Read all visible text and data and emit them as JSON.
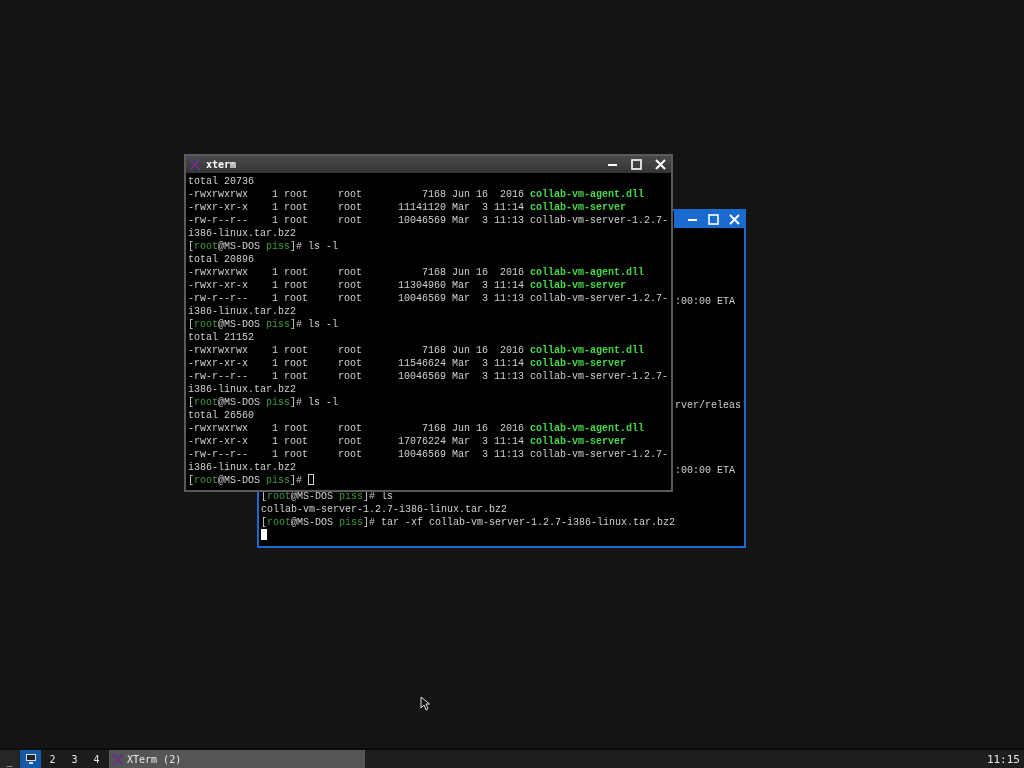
{
  "windows": [
    {
      "kind": "back",
      "focused": true,
      "lines": [
        {
          "kind": "blank"
        },
        {
          "kind": "blank"
        },
        {
          "kind": "blank"
        },
        {
          "kind": "blank"
        },
        {
          "kind": "blank"
        },
        {
          "kind": "tail",
          "segments": [
            {
              "kind": "plain",
              "text": ":00:00 ETA"
            }
          ]
        },
        {
          "kind": "blank"
        },
        {
          "kind": "blank"
        },
        {
          "kind": "blank"
        },
        {
          "kind": "blank"
        },
        {
          "kind": "blank"
        },
        {
          "kind": "blank"
        },
        {
          "kind": "blank"
        },
        {
          "kind": "tail",
          "segments": [
            {
              "kind": "plain",
              "text": "rver/releas"
            }
          ]
        },
        {
          "kind": "blank"
        },
        {
          "kind": "blank"
        },
        {
          "kind": "blank"
        },
        {
          "kind": "blank"
        },
        {
          "kind": "tail",
          "segments": [
            {
              "kind": "plain",
              "text": ":00:00 ETA"
            }
          ]
        },
        {
          "kind": "blank"
        },
        {
          "kind": "full",
          "segments": [
            {
              "kind": "plain",
              "text": "["
            },
            {
              "kind": "prompt",
              "text": "root"
            },
            {
              "kind": "plain",
              "text": "@MS-DOS "
            },
            {
              "kind": "prompt",
              "text": "piss"
            },
            {
              "kind": "plain",
              "text": "]# ls"
            }
          ]
        },
        {
          "kind": "full",
          "segments": [
            {
              "kind": "plain",
              "text": "collab-vm-server-1.2.7-i386-linux.tar.bz2"
            }
          ]
        },
        {
          "kind": "full",
          "segments": [
            {
              "kind": "plain",
              "text": "["
            },
            {
              "kind": "prompt",
              "text": "root"
            },
            {
              "kind": "plain",
              "text": "@MS-DOS "
            },
            {
              "kind": "prompt",
              "text": "piss"
            },
            {
              "kind": "plain",
              "text": "]# tar -xf collab-vm-server-1.2.7-i386-linux.tar.bz2"
            }
          ]
        },
        {
          "kind": "cursor"
        }
      ]
    },
    {
      "kind": "front",
      "title": "xterm",
      "focused": false,
      "lines": [
        {
          "kind": "full",
          "segments": [
            {
              "kind": "plain",
              "text": "total 20736"
            }
          ]
        },
        {
          "kind": "full",
          "segments": [
            {
              "kind": "plain",
              "text": "-rwxrwxrwx    1 root     root          7168 Jun 16  2016 "
            },
            {
              "kind": "exec",
              "text": "collab-vm-agent.dll"
            }
          ]
        },
        {
          "kind": "full",
          "segments": [
            {
              "kind": "plain",
              "text": "-rwxr-xr-x    1 root     root      11141120 Mar  3 11:14 "
            },
            {
              "kind": "exec",
              "text": "collab-vm-server"
            }
          ]
        },
        {
          "kind": "full",
          "segments": [
            {
              "kind": "plain",
              "text": "-rw-r--r--    1 root     root      10046569 Mar  3 11:13 collab-vm-server-1.2.7-"
            }
          ]
        },
        {
          "kind": "full",
          "segments": [
            {
              "kind": "plain",
              "text": "i386-linux.tar.bz2"
            }
          ]
        },
        {
          "kind": "full",
          "segments": [
            {
              "kind": "plain",
              "text": "["
            },
            {
              "kind": "prompt",
              "text": "root"
            },
            {
              "kind": "plain",
              "text": "@MS-DOS "
            },
            {
              "kind": "prompt",
              "text": "piss"
            },
            {
              "kind": "plain",
              "text": "]# ls -l"
            }
          ]
        },
        {
          "kind": "full",
          "segments": [
            {
              "kind": "plain",
              "text": "total 20896"
            }
          ]
        },
        {
          "kind": "full",
          "segments": [
            {
              "kind": "plain",
              "text": "-rwxrwxrwx    1 root     root          7168 Jun 16  2016 "
            },
            {
              "kind": "exec",
              "text": "collab-vm-agent.dll"
            }
          ]
        },
        {
          "kind": "full",
          "segments": [
            {
              "kind": "plain",
              "text": "-rwxr-xr-x    1 root     root      11304960 Mar  3 11:14 "
            },
            {
              "kind": "exec",
              "text": "collab-vm-server"
            }
          ]
        },
        {
          "kind": "full",
          "segments": [
            {
              "kind": "plain",
              "text": "-rw-r--r--    1 root     root      10046569 Mar  3 11:13 collab-vm-server-1.2.7-"
            }
          ]
        },
        {
          "kind": "full",
          "segments": [
            {
              "kind": "plain",
              "text": "i386-linux.tar.bz2"
            }
          ]
        },
        {
          "kind": "full",
          "segments": [
            {
              "kind": "plain",
              "text": "["
            },
            {
              "kind": "prompt",
              "text": "root"
            },
            {
              "kind": "plain",
              "text": "@MS-DOS "
            },
            {
              "kind": "prompt",
              "text": "piss"
            },
            {
              "kind": "plain",
              "text": "]# ls -l"
            }
          ]
        },
        {
          "kind": "full",
          "segments": [
            {
              "kind": "plain",
              "text": "total 21152"
            }
          ]
        },
        {
          "kind": "full",
          "segments": [
            {
              "kind": "plain",
              "text": "-rwxrwxrwx    1 root     root          7168 Jun 16  2016 "
            },
            {
              "kind": "exec",
              "text": "collab-vm-agent.dll"
            }
          ]
        },
        {
          "kind": "full",
          "segments": [
            {
              "kind": "plain",
              "text": "-rwxr-xr-x    1 root     root      11546624 Mar  3 11:14 "
            },
            {
              "kind": "exec",
              "text": "collab-vm-server"
            }
          ]
        },
        {
          "kind": "full",
          "segments": [
            {
              "kind": "plain",
              "text": "-rw-r--r--    1 root     root      10046569 Mar  3 11:13 collab-vm-server-1.2.7-"
            }
          ]
        },
        {
          "kind": "full",
          "segments": [
            {
              "kind": "plain",
              "text": "i386-linux.tar.bz2"
            }
          ]
        },
        {
          "kind": "full",
          "segments": [
            {
              "kind": "plain",
              "text": "["
            },
            {
              "kind": "prompt",
              "text": "root"
            },
            {
              "kind": "plain",
              "text": "@MS-DOS "
            },
            {
              "kind": "prompt",
              "text": "piss"
            },
            {
              "kind": "plain",
              "text": "]# ls -l"
            }
          ]
        },
        {
          "kind": "full",
          "segments": [
            {
              "kind": "plain",
              "text": "total 26560"
            }
          ]
        },
        {
          "kind": "full",
          "segments": [
            {
              "kind": "plain",
              "text": "-rwxrwxrwx    1 root     root          7168 Jun 16  2016 "
            },
            {
              "kind": "exec",
              "text": "collab-vm-agent.dll"
            }
          ]
        },
        {
          "kind": "full",
          "segments": [
            {
              "kind": "plain",
              "text": "-rwxr-xr-x    1 root     root      17076224 Mar  3 11:14 "
            },
            {
              "kind": "exec",
              "text": "collab-vm-server"
            }
          ]
        },
        {
          "kind": "full",
          "segments": [
            {
              "kind": "plain",
              "text": "-rw-r--r--    1 root     root      10046569 Mar  3 11:13 collab-vm-server-1.2.7-"
            }
          ]
        },
        {
          "kind": "full",
          "segments": [
            {
              "kind": "plain",
              "text": "i386-linux.tar.bz2"
            }
          ]
        },
        {
          "kind": "input",
          "segments": [
            {
              "kind": "plain",
              "text": "["
            },
            {
              "kind": "prompt",
              "text": "root"
            },
            {
              "kind": "plain",
              "text": "@MS-DOS "
            },
            {
              "kind": "prompt",
              "text": "piss"
            },
            {
              "kind": "plain",
              "text": "]# "
            }
          ]
        }
      ]
    }
  ],
  "taskbar": {
    "minimize_label": "_",
    "workspaces": [
      {
        "kind": "icon",
        "selected": true
      },
      {
        "label": "2",
        "kind": "text",
        "selected": false
      },
      {
        "label": "3",
        "kind": "text",
        "selected": false
      },
      {
        "label": "4",
        "kind": "text",
        "selected": false
      }
    ],
    "tasks": [
      {
        "label": "XTerm (2)",
        "selected": false
      }
    ],
    "clock": "11:15"
  }
}
